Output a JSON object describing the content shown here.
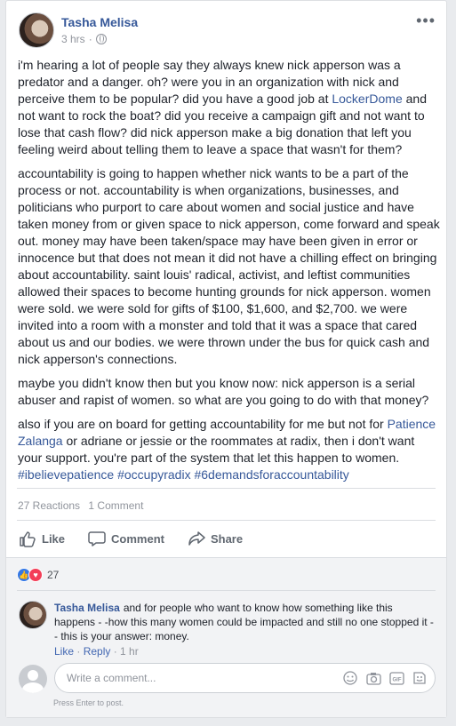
{
  "post": {
    "author": "Tasha Melisa",
    "time": "3 hrs",
    "more_label": "•••",
    "paragraphs": {
      "p1_a": "i'm hearing a lot of people say they always knew nick apperson was a predator and a danger. oh? were you in an organization with nick and perceive them to be popular? did you have a good job at ",
      "p1_link": "LockerDome",
      "p1_b": " and not want to rock the boat? did you receive a campaign gift and not want to lose that cash flow? did nick apperson make a big donation that left you feeling weird about telling them to leave a space that wasn't for them?",
      "p2": "accountability is going to happen whether nick wants to be a part of the process or not. accountability is when organizations, businesses, and politicians who purport to care about women and social justice and have taken money from or given space to nick apperson, come forward and speak out. money may have been taken/space may have been given in error or innocence but that does not mean it did not have a chilling effect on bringing about accountability. saint louis' radical, activist, and leftist communities allowed their spaces to become hunting grounds for nick apperson. women were sold. we were sold for gifts of $100, $1,600, and $2,700. we were invited into a room with a monster and told that it was a space that cared about us and our bodies. we were thrown under the bus for quick cash and nick apperson's connections.",
      "p3": "maybe you didn't know then but you know now: nick apperson is a serial abuser and rapist of women. so what are you going to do with that money?",
      "p4_a": "also if you are on board for getting accountability for me but not for ",
      "p4_link": "Patience Zalanga",
      "p4_b": " or adriane or jessie or the roommates at radix, then i don't want your support. you're part of the system that let this happen to women. ",
      "hashtags": "#ibelievepatience #occupyradix #6demandsforaccountability"
    }
  },
  "stats": {
    "reactions": "27 Reactions",
    "comments": "1 Comment"
  },
  "actions": {
    "like": "Like",
    "comment": "Comment",
    "share": "Share"
  },
  "reactions_bar": {
    "count": "27"
  },
  "comment": {
    "author": "Tasha Melisa",
    "text": "and for people who want to know how something like this happens - -how this many women could be impacted and still no one stopped it -- this is your answer: money.",
    "like": "Like",
    "sep": " · ",
    "reply": "Reply",
    "time": "1 hr"
  },
  "composer": {
    "placeholder": "Write a comment...",
    "hint": "Press Enter to post."
  },
  "colors": {
    "link": "#365899",
    "like_blue": "#3578e5",
    "love_red": "#f33e58"
  }
}
